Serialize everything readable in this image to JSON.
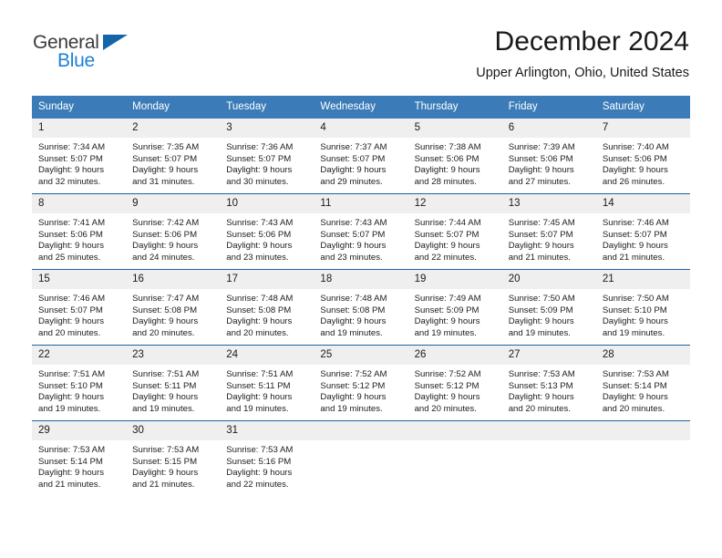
{
  "brand": {
    "name_part1": "General",
    "name_part2": "Blue",
    "triangle_color": "#1464aa",
    "blue_text_color": "#1d81d6"
  },
  "header": {
    "title": "December 2024",
    "subtitle": "Upper Arlington, Ohio, United States"
  },
  "theme": {
    "header_row_bg": "#3b7cb8",
    "week_separator": "#1f62a0",
    "daynum_bg": "#efefef",
    "text": "#1a1a1a"
  },
  "weekday_headers": [
    "Sunday",
    "Monday",
    "Tuesday",
    "Wednesday",
    "Thursday",
    "Friday",
    "Saturday"
  ],
  "labels": {
    "sunrise_prefix": "Sunrise:",
    "sunset_prefix": "Sunset:",
    "daylight_prefix": "Daylight:"
  },
  "weeks": [
    [
      {
        "day": "1",
        "sunrise": "Sunrise: 7:34 AM",
        "sunset": "Sunset: 5:07 PM",
        "daylight_1": "Daylight: 9 hours",
        "daylight_2": "and 32 minutes."
      },
      {
        "day": "2",
        "sunrise": "Sunrise: 7:35 AM",
        "sunset": "Sunset: 5:07 PM",
        "daylight_1": "Daylight: 9 hours",
        "daylight_2": "and 31 minutes."
      },
      {
        "day": "3",
        "sunrise": "Sunrise: 7:36 AM",
        "sunset": "Sunset: 5:07 PM",
        "daylight_1": "Daylight: 9 hours",
        "daylight_2": "and 30 minutes."
      },
      {
        "day": "4",
        "sunrise": "Sunrise: 7:37 AM",
        "sunset": "Sunset: 5:07 PM",
        "daylight_1": "Daylight: 9 hours",
        "daylight_2": "and 29 minutes."
      },
      {
        "day": "5",
        "sunrise": "Sunrise: 7:38 AM",
        "sunset": "Sunset: 5:06 PM",
        "daylight_1": "Daylight: 9 hours",
        "daylight_2": "and 28 minutes."
      },
      {
        "day": "6",
        "sunrise": "Sunrise: 7:39 AM",
        "sunset": "Sunset: 5:06 PM",
        "daylight_1": "Daylight: 9 hours",
        "daylight_2": "and 27 minutes."
      },
      {
        "day": "7",
        "sunrise": "Sunrise: 7:40 AM",
        "sunset": "Sunset: 5:06 PM",
        "daylight_1": "Daylight: 9 hours",
        "daylight_2": "and 26 minutes."
      }
    ],
    [
      {
        "day": "8",
        "sunrise": "Sunrise: 7:41 AM",
        "sunset": "Sunset: 5:06 PM",
        "daylight_1": "Daylight: 9 hours",
        "daylight_2": "and 25 minutes."
      },
      {
        "day": "9",
        "sunrise": "Sunrise: 7:42 AM",
        "sunset": "Sunset: 5:06 PM",
        "daylight_1": "Daylight: 9 hours",
        "daylight_2": "and 24 minutes."
      },
      {
        "day": "10",
        "sunrise": "Sunrise: 7:43 AM",
        "sunset": "Sunset: 5:06 PM",
        "daylight_1": "Daylight: 9 hours",
        "daylight_2": "and 23 minutes."
      },
      {
        "day": "11",
        "sunrise": "Sunrise: 7:43 AM",
        "sunset": "Sunset: 5:07 PM",
        "daylight_1": "Daylight: 9 hours",
        "daylight_2": "and 23 minutes."
      },
      {
        "day": "12",
        "sunrise": "Sunrise: 7:44 AM",
        "sunset": "Sunset: 5:07 PM",
        "daylight_1": "Daylight: 9 hours",
        "daylight_2": "and 22 minutes."
      },
      {
        "day": "13",
        "sunrise": "Sunrise: 7:45 AM",
        "sunset": "Sunset: 5:07 PM",
        "daylight_1": "Daylight: 9 hours",
        "daylight_2": "and 21 minutes."
      },
      {
        "day": "14",
        "sunrise": "Sunrise: 7:46 AM",
        "sunset": "Sunset: 5:07 PM",
        "daylight_1": "Daylight: 9 hours",
        "daylight_2": "and 21 minutes."
      }
    ],
    [
      {
        "day": "15",
        "sunrise": "Sunrise: 7:46 AM",
        "sunset": "Sunset: 5:07 PM",
        "daylight_1": "Daylight: 9 hours",
        "daylight_2": "and 20 minutes."
      },
      {
        "day": "16",
        "sunrise": "Sunrise: 7:47 AM",
        "sunset": "Sunset: 5:08 PM",
        "daylight_1": "Daylight: 9 hours",
        "daylight_2": "and 20 minutes."
      },
      {
        "day": "17",
        "sunrise": "Sunrise: 7:48 AM",
        "sunset": "Sunset: 5:08 PM",
        "daylight_1": "Daylight: 9 hours",
        "daylight_2": "and 20 minutes."
      },
      {
        "day": "18",
        "sunrise": "Sunrise: 7:48 AM",
        "sunset": "Sunset: 5:08 PM",
        "daylight_1": "Daylight: 9 hours",
        "daylight_2": "and 19 minutes."
      },
      {
        "day": "19",
        "sunrise": "Sunrise: 7:49 AM",
        "sunset": "Sunset: 5:09 PM",
        "daylight_1": "Daylight: 9 hours",
        "daylight_2": "and 19 minutes."
      },
      {
        "day": "20",
        "sunrise": "Sunrise: 7:50 AM",
        "sunset": "Sunset: 5:09 PM",
        "daylight_1": "Daylight: 9 hours",
        "daylight_2": "and 19 minutes."
      },
      {
        "day": "21",
        "sunrise": "Sunrise: 7:50 AM",
        "sunset": "Sunset: 5:10 PM",
        "daylight_1": "Daylight: 9 hours",
        "daylight_2": "and 19 minutes."
      }
    ],
    [
      {
        "day": "22",
        "sunrise": "Sunrise: 7:51 AM",
        "sunset": "Sunset: 5:10 PM",
        "daylight_1": "Daylight: 9 hours",
        "daylight_2": "and 19 minutes."
      },
      {
        "day": "23",
        "sunrise": "Sunrise: 7:51 AM",
        "sunset": "Sunset: 5:11 PM",
        "daylight_1": "Daylight: 9 hours",
        "daylight_2": "and 19 minutes."
      },
      {
        "day": "24",
        "sunrise": "Sunrise: 7:51 AM",
        "sunset": "Sunset: 5:11 PM",
        "daylight_1": "Daylight: 9 hours",
        "daylight_2": "and 19 minutes."
      },
      {
        "day": "25",
        "sunrise": "Sunrise: 7:52 AM",
        "sunset": "Sunset: 5:12 PM",
        "daylight_1": "Daylight: 9 hours",
        "daylight_2": "and 19 minutes."
      },
      {
        "day": "26",
        "sunrise": "Sunrise: 7:52 AM",
        "sunset": "Sunset: 5:12 PM",
        "daylight_1": "Daylight: 9 hours",
        "daylight_2": "and 20 minutes."
      },
      {
        "day": "27",
        "sunrise": "Sunrise: 7:53 AM",
        "sunset": "Sunset: 5:13 PM",
        "daylight_1": "Daylight: 9 hours",
        "daylight_2": "and 20 minutes."
      },
      {
        "day": "28",
        "sunrise": "Sunrise: 7:53 AM",
        "sunset": "Sunset: 5:14 PM",
        "daylight_1": "Daylight: 9 hours",
        "daylight_2": "and 20 minutes."
      }
    ],
    [
      {
        "day": "29",
        "sunrise": "Sunrise: 7:53 AM",
        "sunset": "Sunset: 5:14 PM",
        "daylight_1": "Daylight: 9 hours",
        "daylight_2": "and 21 minutes."
      },
      {
        "day": "30",
        "sunrise": "Sunrise: 7:53 AM",
        "sunset": "Sunset: 5:15 PM",
        "daylight_1": "Daylight: 9 hours",
        "daylight_2": "and 21 minutes."
      },
      {
        "day": "31",
        "sunrise": "Sunrise: 7:53 AM",
        "sunset": "Sunset: 5:16 PM",
        "daylight_1": "Daylight: 9 hours",
        "daylight_2": "and 22 minutes."
      },
      {
        "day": "",
        "sunrise": "",
        "sunset": "",
        "daylight_1": "",
        "daylight_2": ""
      },
      {
        "day": "",
        "sunrise": "",
        "sunset": "",
        "daylight_1": "",
        "daylight_2": ""
      },
      {
        "day": "",
        "sunrise": "",
        "sunset": "",
        "daylight_1": "",
        "daylight_2": ""
      },
      {
        "day": "",
        "sunrise": "",
        "sunset": "",
        "daylight_1": "",
        "daylight_2": ""
      }
    ]
  ]
}
